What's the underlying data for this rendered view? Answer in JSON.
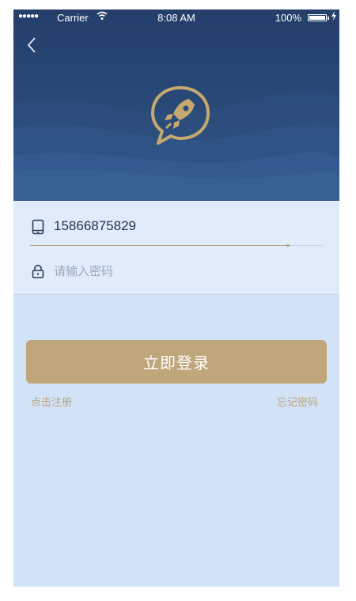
{
  "status_bar": {
    "signal": "●●●●●",
    "carrier": "Carrier",
    "time": "8:08 AM",
    "battery": "100%"
  },
  "header": {
    "back_icon": "chevron-left-icon",
    "logo_icon": "rocket-chat-bubble-icon"
  },
  "form": {
    "phone": {
      "icon": "phone-icon",
      "value": "15866875829"
    },
    "password": {
      "icon": "lock-icon",
      "placeholder": "请输入密码"
    }
  },
  "actions": {
    "login_label": "立即登录",
    "register_label": "点击注册",
    "forgot_label": "忘记密码"
  },
  "colors": {
    "header": "#2a4a78",
    "accent": "#c0a67b",
    "background": "#d3e3f7"
  }
}
